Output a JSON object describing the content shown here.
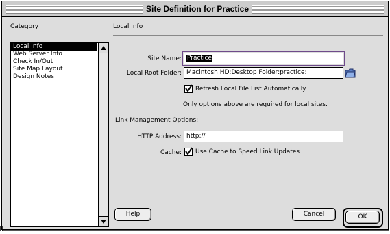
{
  "window": {
    "title": "Site Definition for Practice"
  },
  "category": {
    "label": "Category",
    "items": [
      {
        "label": "Local Info",
        "selected": true
      },
      {
        "label": "Web Server Info",
        "selected": false
      },
      {
        "label": "Check In/Out",
        "selected": false
      },
      {
        "label": "Site Map Layout",
        "selected": false
      },
      {
        "label": "Design Notes",
        "selected": false
      }
    ]
  },
  "local_info": {
    "section_label": "Local Info",
    "site_name_label": "Site Name:",
    "site_name_value": "Practice",
    "root_folder_label": "Local Root Folder:",
    "root_folder_value": "Macintosh HD:Desktop Folder:practice:",
    "refresh_label": "Refresh Local File List Automatically",
    "refresh_checked": true,
    "required_note": "Only options above are required for local sites."
  },
  "link_management": {
    "label": "Link Management Options:",
    "http_label": "HTTP Address:",
    "http_value": "http://",
    "cache_label": "Cache:",
    "cache_checkbox_label": "Use Cache to Speed Link Updates",
    "cache_checked": true
  },
  "buttons": {
    "help": "Help",
    "cancel": "Cancel",
    "ok": "OK"
  },
  "colors": {
    "focus_ring": "#6e4a8a",
    "folder_icon": "#5b7fc4"
  }
}
